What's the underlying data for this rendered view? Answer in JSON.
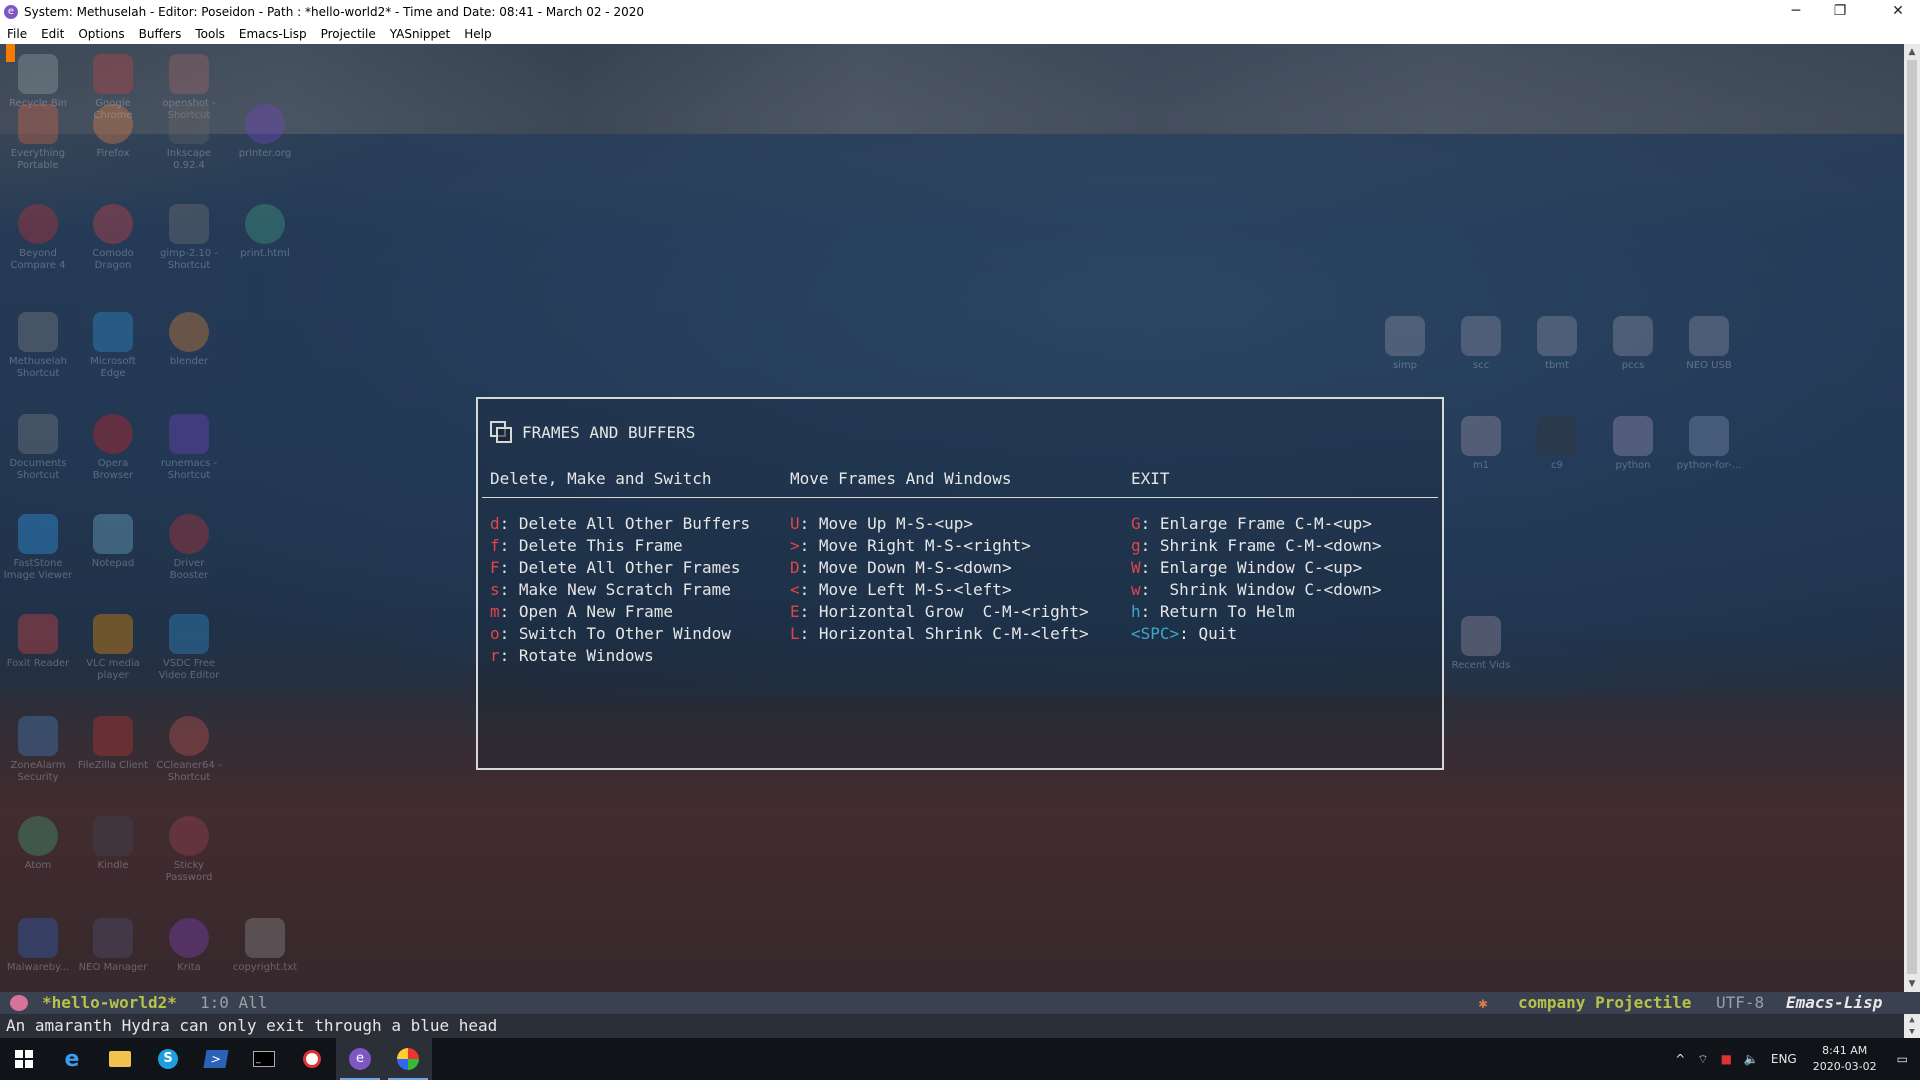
{
  "window": {
    "title": "System: Methuselah - Editor: Poseidon - Path : *hello-world2* - Time and Date: 08:41 - March 02 - 2020",
    "controls": {
      "minimize": "─",
      "restore": "❐",
      "close": "✕"
    }
  },
  "menu": [
    "File",
    "Edit",
    "Options",
    "Buffers",
    "Tools",
    "Emacs-Lisp",
    "Projectile",
    "YASnippet",
    "Help"
  ],
  "desktop_icons": [
    {
      "label": "Recycle Bin"
    },
    {
      "label": "Google Chrome"
    },
    {
      "label": "openshot - Shortcut"
    },
    {
      "label": "Everything Portable"
    },
    {
      "label": "Firefox"
    },
    {
      "label": "Inkscape 0.92.4"
    },
    {
      "label": "printer.org"
    },
    {
      "label": "Beyond Compare 4"
    },
    {
      "label": "Comodo Dragon"
    },
    {
      "label": "gimp-2.10 - Shortcut"
    },
    {
      "label": "print.html"
    },
    {
      "label": "Methuselah Shortcut"
    },
    {
      "label": "Microsoft Edge"
    },
    {
      "label": "blender"
    },
    {
      "label": "Documents Shortcut"
    },
    {
      "label": "Opera Browser"
    },
    {
      "label": "runemacs - Shortcut"
    },
    {
      "label": "FastStone Image Viewer"
    },
    {
      "label": "Notepad"
    },
    {
      "label": "Driver Booster"
    },
    {
      "label": "Foxit Reader"
    },
    {
      "label": "VLC media player"
    },
    {
      "label": "VSDC Free Video Editor"
    },
    {
      "label": "ZoneAlarm Security"
    },
    {
      "label": "FileZilla Client"
    },
    {
      "label": "CCleaner64 - Shortcut"
    },
    {
      "label": "Atom"
    },
    {
      "label": "Kindle"
    },
    {
      "label": "Sticky Password"
    },
    {
      "label": "Malwareby..."
    },
    {
      "label": "NEO Manager"
    },
    {
      "label": "Krita"
    },
    {
      "label": "copyright.txt"
    },
    {
      "label": "simp"
    },
    {
      "label": "scc"
    },
    {
      "label": "tbmt"
    },
    {
      "label": "pccs"
    },
    {
      "label": "NEO USB"
    },
    {
      "label": "m1"
    },
    {
      "label": "c9"
    },
    {
      "label": "python"
    },
    {
      "label": "python-for-..."
    },
    {
      "label": "Recent Vids"
    }
  ],
  "hydra": {
    "title": "FRAMES AND BUFFERS",
    "columns": [
      {
        "header": "Delete, Make and Switch",
        "items": [
          {
            "key": "d",
            "text": " Delete All Other Buffers",
            "color": "red"
          },
          {
            "key": "f",
            "text": " Delete This Frame",
            "color": "red"
          },
          {
            "key": "F",
            "text": " Delete All Other Frames",
            "color": "red"
          },
          {
            "key": "s",
            "text": " Make New Scratch Frame",
            "color": "red"
          },
          {
            "key": "m",
            "text": " Open A New Frame",
            "color": "red"
          },
          {
            "key": "o",
            "text": " Switch To Other Window",
            "color": "red"
          },
          {
            "key": "r",
            "text": " Rotate Windows",
            "color": "red"
          }
        ]
      },
      {
        "header": "Move Frames And Windows",
        "items": [
          {
            "key": "U",
            "text": " Move Up M-S-<up>",
            "color": "red"
          },
          {
            "key": ">",
            "text": " Move Right M-S-<right>",
            "color": "red"
          },
          {
            "key": "D",
            "text": " Move Down M-S-<down>",
            "color": "red"
          },
          {
            "key": "<",
            "text": " Move Left M-S-<left>",
            "color": "red"
          },
          {
            "key": "E",
            "text": " Horizontal Grow  C-M-<right>",
            "color": "red"
          },
          {
            "key": "L",
            "text": " Horizontal Shrink C-M-<left>",
            "color": "red"
          }
        ]
      },
      {
        "header": "EXIT",
        "items": [
          {
            "key": "G",
            "text": " Enlarge Frame C-M-<up>",
            "color": "red"
          },
          {
            "key": "g",
            "text": " Shrink Frame C-M-<down>",
            "color": "red"
          },
          {
            "key": "W",
            "text": " Enlarge Window C-<up>",
            "color": "red"
          },
          {
            "key": "w",
            "text": "  Shrink Window C-<down>",
            "color": "red"
          },
          {
            "key": "h",
            "text": " Return To Helm",
            "color": "blue"
          },
          {
            "key": "<SPC>",
            "text": " Quit",
            "color": "blue"
          }
        ]
      }
    ]
  },
  "modeline": {
    "buffer": "*hello-world2*",
    "position": "1:0 All",
    "company": "company Projectile",
    "encoding": "UTF-8",
    "major_mode": "Emacs-Lisp"
  },
  "echo": "An amaranth Hydra can only exit through a blue head",
  "taskbar": {
    "apps": [
      "windows-start",
      "edge",
      "file-explorer",
      "skype",
      "powershell",
      "terminal",
      "app-red",
      "emacs",
      "app-multicolor"
    ],
    "tray": {
      "chevron": "^",
      "language": "ENG",
      "time": "8:41 AM",
      "date": "2020-03-02"
    }
  },
  "colors": {
    "key_red": "#e0454a",
    "key_blue": "#3fa8c8",
    "modeline_buffer": "#b8c24a",
    "cursor": "#f57c00"
  }
}
